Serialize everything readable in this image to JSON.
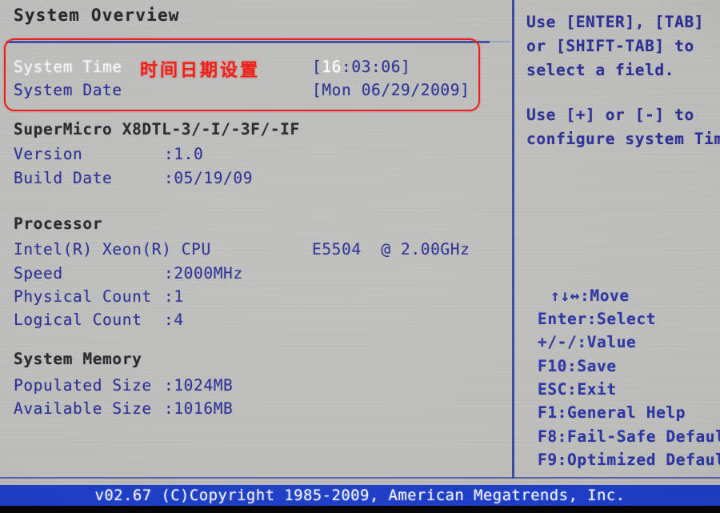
{
  "screen": {
    "title": "System Overview",
    "bg_color": "#bdbdbb",
    "text_color": "#2b2f96",
    "highlight_color": "#ffffff",
    "accent_color": "#1d3ec6",
    "annotation_color": "#ed1b1b"
  },
  "annotation": {
    "text": "时间日期设置"
  },
  "datetime": {
    "time_label": "System Time",
    "time_value_prefix": "[",
    "time_value_selected": "16",
    "time_value_rest": ":03:06]",
    "time_value_full": "[16:03:06]",
    "date_label": "System Date",
    "date_value": "[Mon 06/29/2009]"
  },
  "board": {
    "model": "SuperMicro X8DTL-3/-I/-3F/-IF",
    "version_label": "Version",
    "version_value": ":1.0",
    "build_label": "Build Date",
    "build_value": ":05/19/09"
  },
  "processor": {
    "section": "Processor",
    "cpu_name": "Intel(R) Xeon(R) CPU",
    "cpu_model": "E5504  @ 2.00GHz",
    "speed_label": "Speed",
    "speed_value": ":2000MHz",
    "physical_label": "Physical Count",
    "physical_value": ":1",
    "logical_label": "Logical Count",
    "logical_value": ":4"
  },
  "memory": {
    "section": "System Memory",
    "populated_label": "Populated Size",
    "populated_value": ":1024MB",
    "available_label": "Available Size",
    "available_value": ":1016MB"
  },
  "help": {
    "lines": [
      "Use [ENTER], [TAB]",
      "or [SHIFT-TAB] to",
      "select a field.",
      "Use [+] or [-] to",
      "configure system Time"
    ]
  },
  "keys": [
    {
      "label": "↑↓↔:Move"
    },
    {
      "label": "Enter:Select"
    },
    {
      "label": "+/-/:Value"
    },
    {
      "label": "F10:Save"
    },
    {
      "label": "ESC:Exit"
    },
    {
      "label": "F1:General Help"
    },
    {
      "label": "F8:Fail-Safe Defaul"
    },
    {
      "label": "F9:Optimized Defaul"
    }
  ],
  "statusbar": {
    "text": "v02.67 (C)Copyright 1985-2009, American Megatrends, Inc."
  }
}
